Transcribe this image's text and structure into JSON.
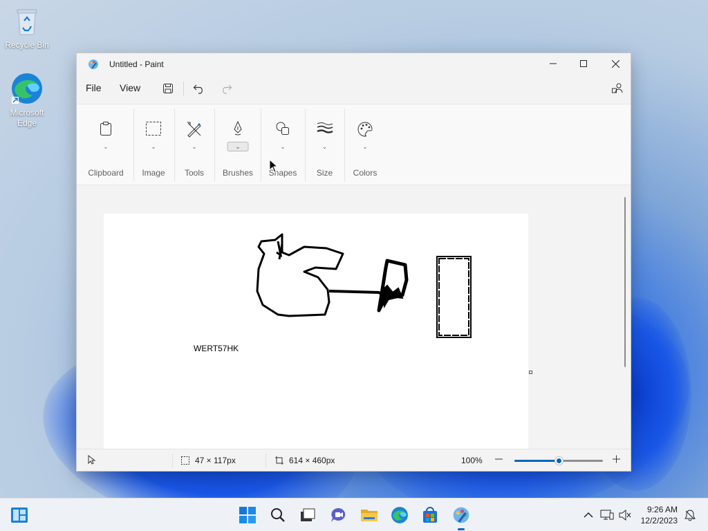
{
  "desktop": {
    "icons": [
      {
        "label": "Recycle Bin"
      },
      {
        "label": "Microsoft Edge"
      }
    ]
  },
  "window": {
    "title": "Untitled - Paint",
    "menu": {
      "file": "File",
      "view": "View"
    }
  },
  "ribbon": {
    "groups": [
      {
        "label": "Clipboard",
        "icon": "clipboard-icon"
      },
      {
        "label": "Image",
        "icon": "selection-icon"
      },
      {
        "label": "Tools",
        "icon": "tools-icon"
      },
      {
        "label": "Brushes",
        "icon": "brush-icon"
      },
      {
        "label": "Shapes",
        "icon": "shapes-icon"
      },
      {
        "label": "Size",
        "icon": "size-icon"
      },
      {
        "label": "Colors",
        "icon": "palette-icon"
      }
    ]
  },
  "canvas": {
    "text": "WERT57HK"
  },
  "status": {
    "selection_size": "47 × 117px",
    "canvas_size": "614 × 460px",
    "zoom": "100%",
    "zoom_level": 0.5
  },
  "taskbar": {
    "time": "9:26 AM",
    "date": "12/2/2023"
  },
  "colors": {
    "accent": "#0067c0"
  }
}
